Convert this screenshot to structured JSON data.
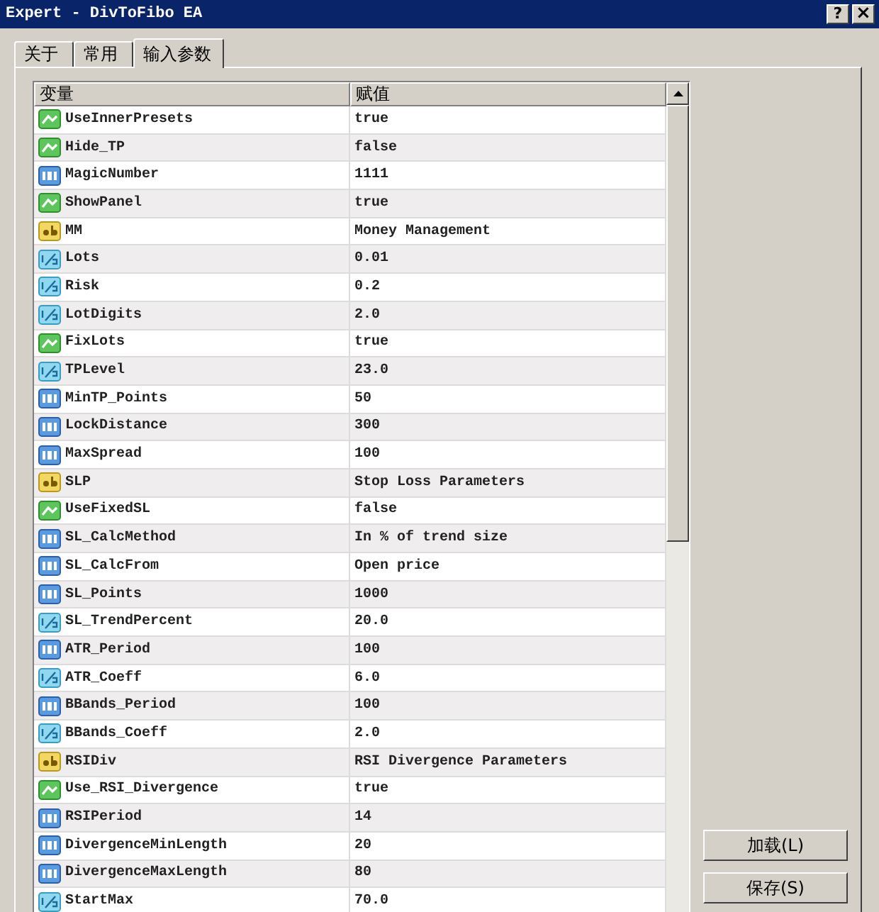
{
  "window": {
    "title": "Expert - DivToFibo EA",
    "buttons": [
      {
        "kind": "help",
        "label": "?"
      },
      {
        "kind": "close",
        "label": "×"
      }
    ]
  },
  "tabs": [
    {
      "label": "关于",
      "selected": false
    },
    {
      "label": "常用",
      "selected": false
    },
    {
      "label": "输入参数",
      "selected": true
    }
  ],
  "table": {
    "columns": [
      "变量",
      "赋值"
    ],
    "rows": [
      {
        "kind": "bool",
        "name": "UseInnerPresets",
        "value": "true"
      },
      {
        "kind": "bool",
        "name": "Hide_TP",
        "value": "false"
      },
      {
        "kind": "int",
        "name": "MagicNumber",
        "value": "1111"
      },
      {
        "kind": "bool",
        "name": "ShowPanel",
        "value": "true"
      },
      {
        "kind": "string",
        "name": "MM",
        "value": "Money Management"
      },
      {
        "kind": "double",
        "name": "Lots",
        "value": "0.01"
      },
      {
        "kind": "double",
        "name": "Risk",
        "value": "0.2"
      },
      {
        "kind": "double",
        "name": "LotDigits",
        "value": "2.0"
      },
      {
        "kind": "bool",
        "name": "FixLots",
        "value": "true"
      },
      {
        "kind": "double",
        "name": "TPLevel",
        "value": "23.0"
      },
      {
        "kind": "int",
        "name": "MinTP_Points",
        "value": "50"
      },
      {
        "kind": "int",
        "name": "LockDistance",
        "value": "300"
      },
      {
        "kind": "int",
        "name": "MaxSpread",
        "value": "100"
      },
      {
        "kind": "string",
        "name": "SLP",
        "value": "Stop Loss Parameters"
      },
      {
        "kind": "bool",
        "name": "UseFixedSL",
        "value": "false"
      },
      {
        "kind": "int",
        "name": "SL_CalcMethod",
        "value": "In % of trend size"
      },
      {
        "kind": "int",
        "name": "SL_CalcFrom",
        "value": "Open price"
      },
      {
        "kind": "int",
        "name": "SL_Points",
        "value": "1000"
      },
      {
        "kind": "double",
        "name": "SL_TrendPercent",
        "value": "20.0"
      },
      {
        "kind": "int",
        "name": "ATR_Period",
        "value": "100"
      },
      {
        "kind": "double",
        "name": "ATR_Coeff",
        "value": "6.0"
      },
      {
        "kind": "int",
        "name": "BBands_Period",
        "value": "100"
      },
      {
        "kind": "double",
        "name": "BBands_Coeff",
        "value": "2.0"
      },
      {
        "kind": "string",
        "name": "RSIDiv",
        "value": "RSI Divergence Parameters"
      },
      {
        "kind": "bool",
        "name": "Use_RSI_Divergence",
        "value": "true"
      },
      {
        "kind": "int",
        "name": "RSIPeriod",
        "value": "14"
      },
      {
        "kind": "int",
        "name": "DivergenceMinLength",
        "value": "20"
      },
      {
        "kind": "int",
        "name": "DivergenceMaxLength",
        "value": "80"
      },
      {
        "kind": "double",
        "name": "StartMax",
        "value": "70.0"
      }
    ]
  },
  "buttons": [
    "加载(L)",
    "保存(S)"
  ]
}
